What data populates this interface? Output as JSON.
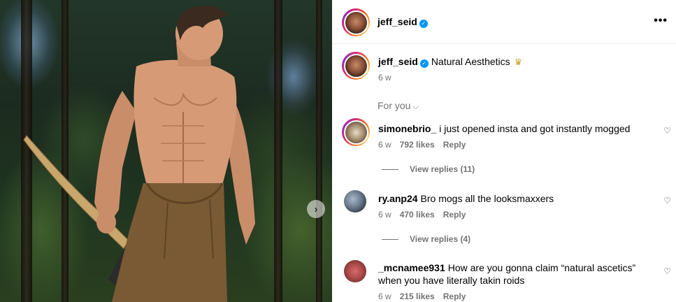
{
  "post": {
    "author": "jeff_seid",
    "caption": "Natural Aesthetics",
    "caption_emoji": "crown-icon",
    "age": "6 w",
    "more_icon": "more-options-icon"
  },
  "comments_section": {
    "sort_label": "For you",
    "sort_icon": "chevron-down-icon"
  },
  "comments": [
    {
      "user": "simonebrio_",
      "text": "i just opened insta and got instantly mogged",
      "age": "6 w",
      "likes": "792 likes",
      "reply": "Reply",
      "view_replies": "View replies (11)"
    },
    {
      "user": "ry.anp24",
      "text": "Bro mogs all the looksmaxxers",
      "age": "6 w",
      "likes": "470 likes",
      "reply": "Reply",
      "view_replies": "View replies (4)"
    },
    {
      "user": "_mcnamee931",
      "text": "How are you gonna claim “natural ascetics” when you have literally takin roids",
      "age": "6 w",
      "likes": "215 likes",
      "reply": "Reply"
    }
  ],
  "colors": {
    "verified": "#0095f6",
    "muted": "#737373"
  }
}
